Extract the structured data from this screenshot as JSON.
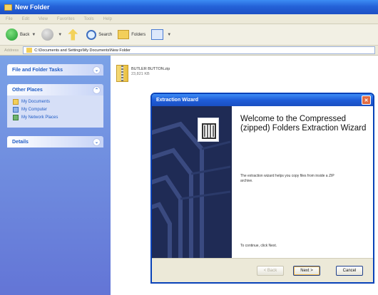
{
  "window": {
    "title": "New Folder",
    "menu": [
      "File",
      "Edit",
      "View",
      "Favorites",
      "Tools",
      "Help"
    ]
  },
  "toolbar": {
    "back_label": "Back",
    "search_label": "Search",
    "folders_label": "Folders"
  },
  "address": {
    "label": "Address",
    "path": "C:\\Documents and Settings\\My Documents\\New Folder"
  },
  "taskpane": {
    "file_tasks_title": "File and Folder Tasks",
    "other_places_title": "Other Places",
    "places": [
      "My Documents",
      "My Computer",
      "My Network Places"
    ],
    "details_title": "Details"
  },
  "file": {
    "name": "BUTLER BUTTON.zip",
    "size": "23,821 KB"
  },
  "wizard": {
    "title": "Extraction Wizard",
    "heading": "Welcome to the Compressed (zipped) Folders Extraction Wizard",
    "description": "The extraction wizard helps you copy files from inside a ZIP archive.",
    "continue_text": "To continue, click Next.",
    "back_button": "< Back",
    "next_button": "Next >",
    "cancel_button": "Cancel"
  },
  "colors": {
    "title_blue": "#2462d8",
    "taskpane_blue": "#6f8ce0",
    "wizard_art": "#1f2b55"
  }
}
